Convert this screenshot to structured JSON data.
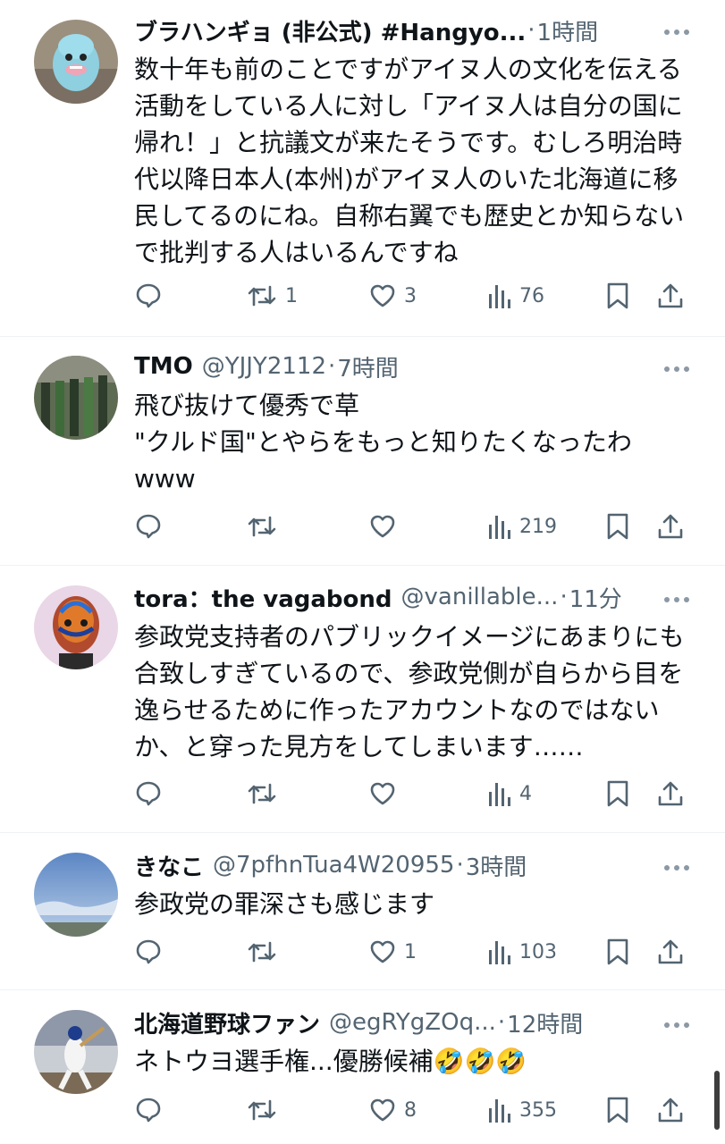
{
  "tweets": [
    {
      "name": "ブラハンギョ (非公式) #Hangyo...",
      "handle": "",
      "time": "1時間",
      "text": "数十年も前のことですがアイヌ人の文化を伝える活動をしている人に対し「アイヌ人は自分の国に帰れ！」と抗議文が来たそうです。むしろ明治時代以降日本人(本州)がアイヌ人のいた北海道に移民してるのにね。自称右翼でも歴史とか知らないで批判する人はいるんですね",
      "replies": "",
      "retweets": "1",
      "likes": "3",
      "views": "76",
      "avatar": "hangyodon-avatar"
    },
    {
      "name": "TMO",
      "handle": "@YJJY2112",
      "time": "7時間",
      "text": "飛び抜けて優秀で草\n\"クルド国\"とやらをもっと知りたくなったわwww",
      "replies": "",
      "retweets": "",
      "likes": "",
      "views": "219",
      "avatar": "machinery-avatar"
    },
    {
      "name": "tora：the vagabond",
      "handle": "@vanillable...",
      "time": "11分",
      "text": "参政党支持者のパブリックイメージにあまりにも合致しすぎているので、参政党側が自らから目を逸らせるために作ったアカウントなのではないか、と穿った見方をしてしまいます……",
      "replies": "",
      "retweets": "",
      "likes": "",
      "views": "4",
      "avatar": "colorful-head-avatar"
    },
    {
      "name": "きなこ",
      "handle": "@7pfhnTua4W20955",
      "time": "3時間",
      "text": "参政党の罪深さも感じます",
      "replies": "",
      "retweets": "",
      "likes": "1",
      "views": "103",
      "avatar": "sky-avatar"
    },
    {
      "name": "北海道野球ファン",
      "handle": "@egRYgZOq...",
      "time": "12時間",
      "text": "ネトウヨ選手権...優勝候補🤣🤣🤣",
      "replies": "",
      "retweets": "",
      "likes": "8",
      "views": "355",
      "avatar": "baseball-avatar"
    }
  ],
  "colors": {
    "text": "#0f1419",
    "secondary": "#536471",
    "divider": "#eff3f4"
  }
}
